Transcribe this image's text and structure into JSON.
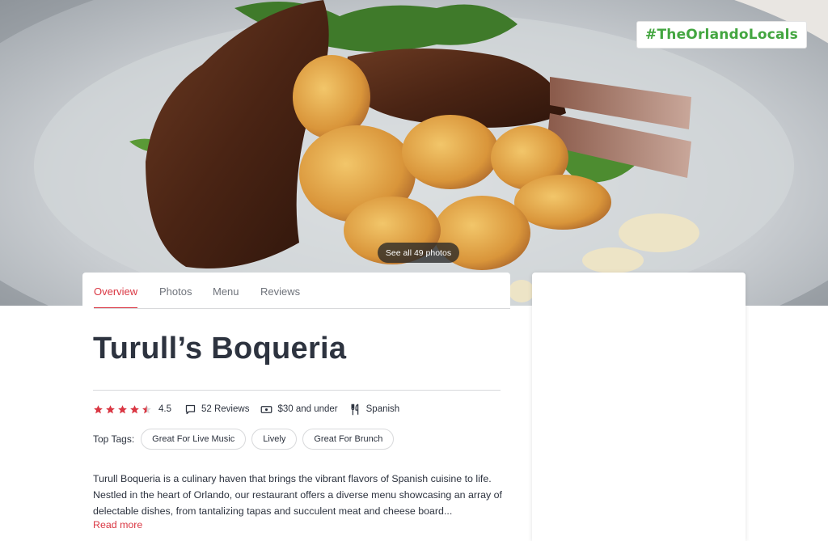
{
  "hero": {
    "hashtag": "#TheOrlandoLocals",
    "see_photos": "See all 49 photos"
  },
  "tabs": [
    {
      "label": "Overview",
      "active": true
    },
    {
      "label": "Photos",
      "active": false
    },
    {
      "label": "Menu",
      "active": false
    },
    {
      "label": "Reviews",
      "active": false
    }
  ],
  "restaurant": {
    "name": "Turull’s Boqueria",
    "rating": 4.5,
    "rating_text": "4.5",
    "reviews": "52 Reviews",
    "price": "$30 and under",
    "cuisine": "Spanish",
    "top_tags_label": "Top Tags:",
    "tags": [
      "Great For Live Music",
      "Lively",
      "Great For Brunch"
    ],
    "description": "Turull Boqueria is a culinary haven that brings the vibrant flavors of Spanish cuisine to life. Nestled in the heart of Orlando, our restaurant offers a diverse menu showcasing an array of delectable dishes, from tantalizing tapas and succulent meat and cheese board...",
    "read_more": "Read more"
  },
  "colors": {
    "accent": "#da3743",
    "hashtag": "#43a640",
    "text": "#2d333f"
  },
  "icons": [
    "star-icon",
    "review-bubble-icon",
    "money-icon",
    "fork-knife-icon"
  ]
}
